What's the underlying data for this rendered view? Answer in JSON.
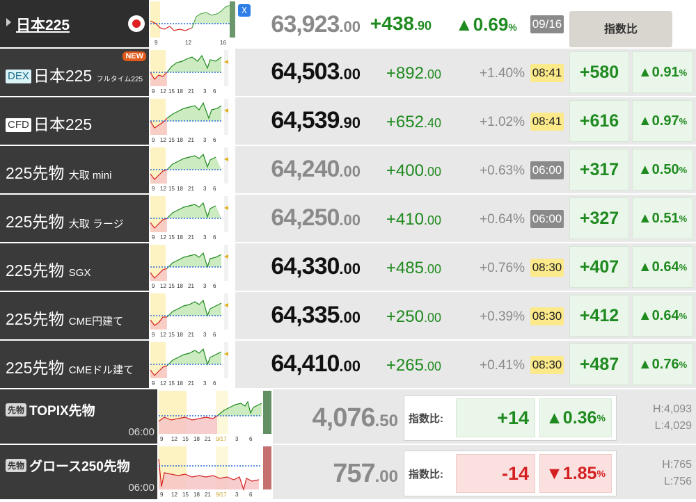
{
  "header": {
    "name": "日本225",
    "x_icon": "x-logo-icon",
    "price_int": "63,923",
    "price_dec": ".00",
    "change_int": "+438",
    "change_dec": ".90",
    "pct": "▲0.69",
    "pct_unit": "%",
    "date": "09/16",
    "compare_header": "指数比",
    "chart_ticks": [
      "9",
      "12",
      "16"
    ]
  },
  "rows": [
    {
      "tag": "DEX",
      "name": "日本225",
      "sub": "フルタイム225",
      "new": "NEW",
      "price_int": "64,503",
      "price_dec": ".00",
      "change_int": "+892",
      "change_dec": ".00",
      "pct": "+1.40%",
      "time": "08:41",
      "cmp_abs": "+580",
      "cmp_pct": "▲0.91",
      "cmp_unit": "%"
    },
    {
      "tag": "CFD",
      "name": "日本225",
      "sub": "",
      "price_int": "64,539",
      "price_dec": ".90",
      "change_int": "+652",
      "change_dec": ".40",
      "pct": "+1.02%",
      "time": "08:41",
      "cmp_abs": "+616",
      "cmp_pct": "▲0.97",
      "cmp_unit": "%"
    },
    {
      "tag": "",
      "name": "225先物",
      "sub": "大取 mini",
      "price_int": "64,240",
      "price_dec": ".00",
      "change_int": "+400",
      "change_dec": ".00",
      "pct": "+0.63%",
      "time": "06:00",
      "cmp_abs": "+317",
      "cmp_pct": "▲0.50",
      "cmp_unit": "%"
    },
    {
      "tag": "",
      "name": "225先物",
      "sub": "大取 ラージ",
      "price_int": "64,250",
      "price_dec": ".00",
      "change_int": "+410",
      "change_dec": ".00",
      "pct": "+0.64%",
      "time": "06:00",
      "cmp_abs": "+327",
      "cmp_pct": "▲0.51",
      "cmp_unit": "%"
    },
    {
      "tag": "",
      "name": "225先物",
      "sub": "SGX",
      "price_int": "64,330",
      "price_dec": ".00",
      "change_int": "+485",
      "change_dec": ".00",
      "pct": "+0.76%",
      "time": "08:30",
      "cmp_abs": "+407",
      "cmp_pct": "▲0.64",
      "cmp_unit": "%"
    },
    {
      "tag": "",
      "name": "225先物",
      "sub": "CME円建て",
      "price_int": "64,335",
      "price_dec": ".00",
      "change_int": "+250",
      "change_dec": ".00",
      "pct": "+0.39%",
      "time": "08:30",
      "cmp_abs": "+412",
      "cmp_pct": "▲0.64",
      "cmp_unit": "%"
    },
    {
      "tag": "",
      "name": "225先物",
      "sub": "CMEドル建て",
      "price_int": "64,410",
      "price_dec": ".00",
      "change_int": "+265",
      "change_dec": ".00",
      "pct": "+0.41%",
      "time": "08:30",
      "cmp_abs": "+487",
      "cmp_pct": "▲0.76",
      "cmp_unit": "%"
    }
  ],
  "row_chart_ticks": [
    "9",
    "12",
    "15",
    "18",
    "21",
    "3",
    "6"
  ],
  "bottom": [
    {
      "pill": "先物",
      "name": "TOPIX先物",
      "time": "06:00",
      "price_int": "4,076",
      "price_dec": ".50",
      "label": "指数比:",
      "cmp_abs": "+14",
      "cmp_pct": "▲0.36",
      "cmp_unit": "%",
      "high": "H:4,093",
      "low": "L:4,029",
      "ticks": [
        "9",
        "12",
        "15",
        "18",
        "21",
        "9/17",
        "3",
        "6"
      ]
    },
    {
      "pill": "先物",
      "name": "グロース250先物",
      "time": "06:00",
      "price_int": "757",
      "price_dec": ".00",
      "label": "指数比:",
      "cmp_abs": "-14",
      "cmp_pct": "▼1.85",
      "cmp_unit": "%",
      "high": "H:765",
      "low": "L:756",
      "ticks": [
        "9",
        "12",
        "15",
        "18",
        "21",
        "9/17",
        "3",
        "6"
      ]
    }
  ],
  "colors": {
    "dark_cell": "#3a3a3a",
    "data_bg": "#e8e8e8",
    "up_green": "#1f8a1f",
    "down_red": "#d42020",
    "time_yellow": "#fbe98a",
    "time_gray": "#8a8a8a"
  }
}
